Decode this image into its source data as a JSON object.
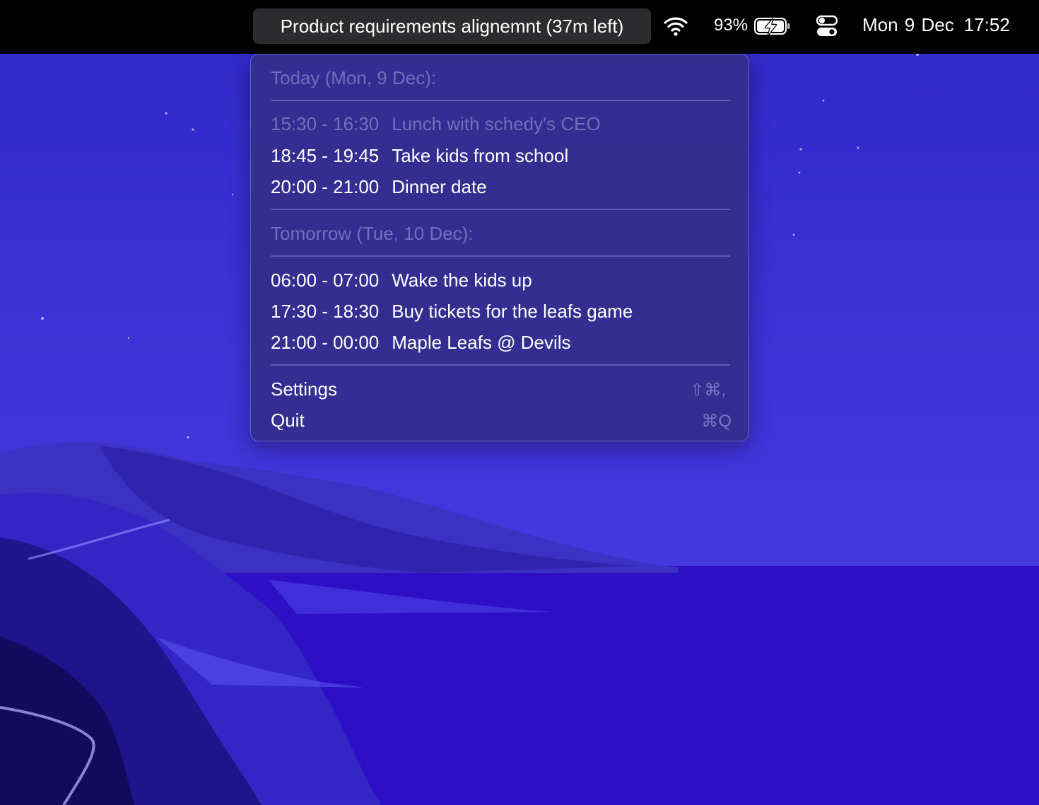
{
  "menubar": {
    "active_event": "Product requirements alignemnt (37m left)",
    "battery_percent": "93%",
    "date": "Mon 9 Dec",
    "time": "17:52",
    "icons": [
      "wifi-icon",
      "battery-charging-icon",
      "control-center-icon"
    ]
  },
  "menu": {
    "today_header": "Today (Mon, 9 Dec):",
    "today_events": [
      {
        "time": "15:30 - 16:30",
        "title": "Lunch with schedy's CEO",
        "past": true
      },
      {
        "time": "18:45 - 19:45",
        "title": "Take kids from school",
        "past": false
      },
      {
        "time": "20:00 - 21:00",
        "title": "Dinner date",
        "past": false
      }
    ],
    "tomorrow_header": "Tomorrow (Tue, 10 Dec):",
    "tomorrow_events": [
      {
        "time": "06:00 - 07:00",
        "title": "Wake the kids up"
      },
      {
        "time": "17:30 - 18:30",
        "title": "Buy tickets for the leafs game"
      },
      {
        "time": "21:00 - 00:00",
        "title": "Maple Leafs @ Devils"
      }
    ],
    "settings_label": "Settings",
    "settings_shortcut": "⇧⌘,",
    "quit_label": "Quit",
    "quit_shortcut": "⌘Q"
  },
  "colors": {
    "menubar_bg": "#000000",
    "menu_bg": "#342e8c",
    "wallpaper_sky": "#3a2fd6",
    "wallpaper_sea": "#2c0fc4"
  }
}
